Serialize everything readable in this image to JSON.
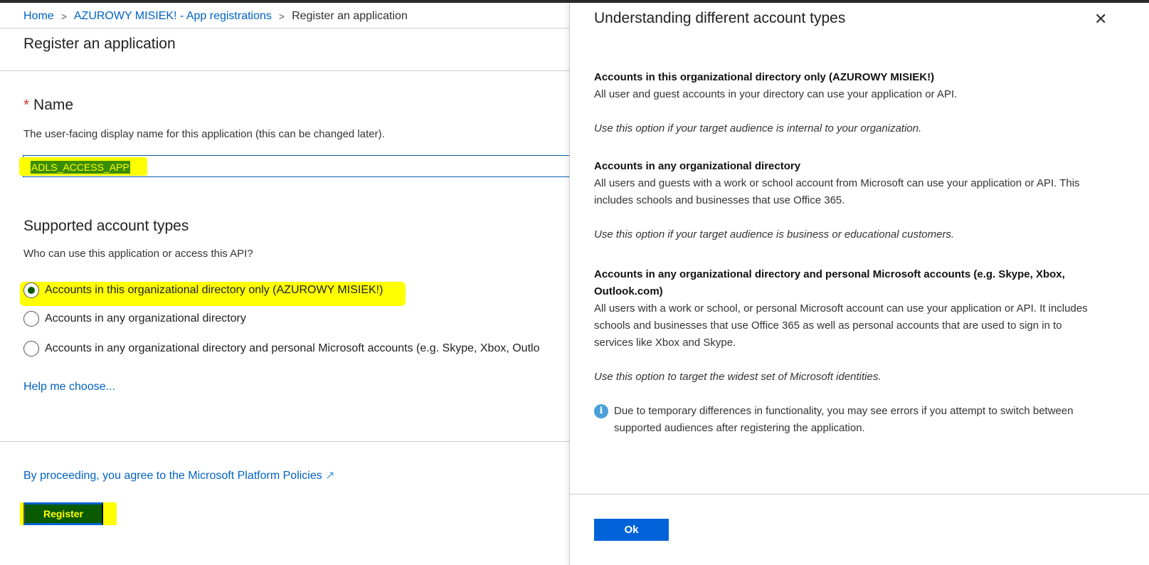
{
  "breadcrumb": [
    "Home",
    "AZUROWY MISIEK! - App registrations",
    "Register an application"
  ],
  "page_title": "Register an application",
  "name_section": {
    "required_mark": "*",
    "label": "Name",
    "description": "The user-facing display name for this application (this can be changed later).",
    "value": "ADLS_ACCESS_APP"
  },
  "account_types": {
    "label": "Supported account types",
    "question": "Who can use this application or access this API?",
    "options": [
      "Accounts in this organizational directory only (AZUROWY MISIEK!)",
      "Accounts in any organizational directory",
      "Accounts in any organizational directory and personal Microsoft accounts (e.g. Skype, Xbox, Outlo"
    ],
    "selected_index": 0,
    "help_link": "Help me choose..."
  },
  "policy_link": "By proceeding, you agree to the Microsoft Platform Policies",
  "register_label": "Register",
  "panel": {
    "title": "Understanding different account types",
    "sections": [
      {
        "heading": "Accounts in this organizational directory only (AZUROWY MISIEK!)",
        "body": "All user and guest accounts in your directory can use your application or API.",
        "note": "Use this option if your target audience is internal to your organization."
      },
      {
        "heading": "Accounts in any organizational directory",
        "body": "All users and guests with a work or school account from Microsoft can use your application or API. This includes schools and businesses that use Office 365.",
        "note": "Use this option if your target audience is business or educational customers."
      },
      {
        "heading": "Accounts in any organizational directory and personal Microsoft accounts (e.g. Skype, Xbox, Outlook.com)",
        "body": "All users with a work or school, or personal Microsoft account can use your application or API. It includes schools and businesses that use Office 365 as well as personal accounts that are used to sign in to services like Xbox and Skype.",
        "note": "Use this option to target the widest set of Microsoft identities."
      }
    ],
    "info": "Due to temporary differences in functionality, you may see errors if you attempt to switch between supported audiences after registering the application.",
    "ok_label": "Ok"
  }
}
